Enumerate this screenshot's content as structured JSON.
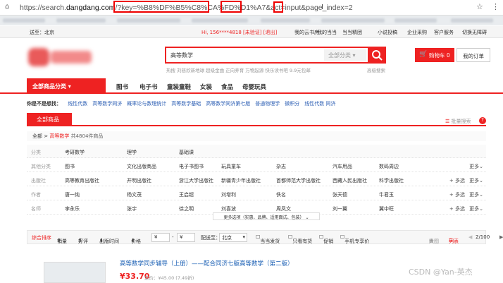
{
  "browser": {
    "url_prefix": "https://search.",
    "url_domain": "dangdang.com",
    "url_path": "/?key=",
    "url_key": "%B8%DF%B5%C8%CA%FD%D1%A7",
    "url_mid": "&act=",
    "url_act": "input",
    "url_param": "&page_index=",
    "url_page": "2"
  },
  "topnav": {
    "delivery": "送至：北京",
    "user": "Hi, 156****4818 [未验证] [退出]",
    "links": [
      "我的云书房",
      "我的当当",
      "当当精团",
      "小说投稿",
      "企业采购",
      "客户服务",
      "切换无障碍"
    ]
  },
  "search": {
    "query": "高等数学",
    "category": "全部分类",
    "advanced": "高级搜索",
    "hot": "热搜   刘慈欣新地球   超级金曲   正向养育   万物起源   快乐读书吧   9.9元包邮"
  },
  "cart": {
    "cart_label": "购物车 0",
    "orders_label": "我的订单"
  },
  "nav": {
    "all": "全部商品分类",
    "items": [
      "图书",
      "电子书",
      "童装童鞋",
      "女装",
      "食品",
      "母婴玩具"
    ]
  },
  "related": {
    "label": "你是不是想找：",
    "items": [
      "线性代数",
      "高等数学同济",
      "概率论与数理统计",
      "高等数学基础",
      "高等数学同济第七版",
      "普通物理学",
      "微积分",
      "线性代数 同济"
    ]
  },
  "tab": {
    "all": "全部商品",
    "batch": "批量搜索"
  },
  "bread": {
    "root": "全部",
    "sep": ">",
    "keyword": "高等数学",
    "count": "共4804件商品"
  },
  "filters": [
    {
      "label": "分类",
      "values": [
        "考研数学",
        "理学",
        "基础课"
      ],
      "more": "",
      "multi": ""
    },
    {
      "label": "其他分类",
      "values": [
        "图书",
        "文化出版商品",
        "电子书图书",
        "玩具童车",
        "杂志",
        "汽车用品",
        "数码周边"
      ],
      "more": "更多",
      "multi": ""
    },
    {
      "label": "出版社",
      "values": [
        "高等教育出版社",
        "开明出版社",
        "浙江大学出版社",
        "新疆青少年出版社",
        "首都师范大学出版社",
        "西藏人民出版社",
        "科学出版社"
      ],
      "more": "更多",
      "multi": "+ 多选"
    },
    {
      "label": "作者",
      "values": [
        "唐一纯",
        "杨文茂",
        "王启超",
        "刘增利",
        "佚名",
        "张天德",
        "牛君玉"
      ],
      "more": "更多",
      "multi": "+ 多选"
    },
    {
      "label": "名师",
      "values": [
        "李永乐",
        "张宇",
        "徐之明",
        "刘喜波",
        "周凤文",
        "刘一翼",
        "翼中旺"
      ],
      "more": "更多",
      "multi": "+ 多选"
    }
  ],
  "more_options": "更多选项（实惠、品牌、适用面试、包装）",
  "sort": {
    "items": [
      "综合排序",
      "销量",
      "好评",
      "出版时间",
      "价格"
    ],
    "currency": "¥",
    "to": "-",
    "ship_to": "配送至：",
    "ship_city": "北京",
    "checks": [
      "当当发货",
      "只看有货",
      "促销",
      "手机专享价"
    ],
    "view_big": "大图",
    "view_list": "列表",
    "page": "2/100"
  },
  "product": {
    "title": "高等数学同步辅导（上册）——配合同济七版高等数学（第二版）",
    "price": "¥33.70",
    "orig": "定价：¥45.00 (7.49折)"
  },
  "watermark": "CSDN @Yan-英杰"
}
